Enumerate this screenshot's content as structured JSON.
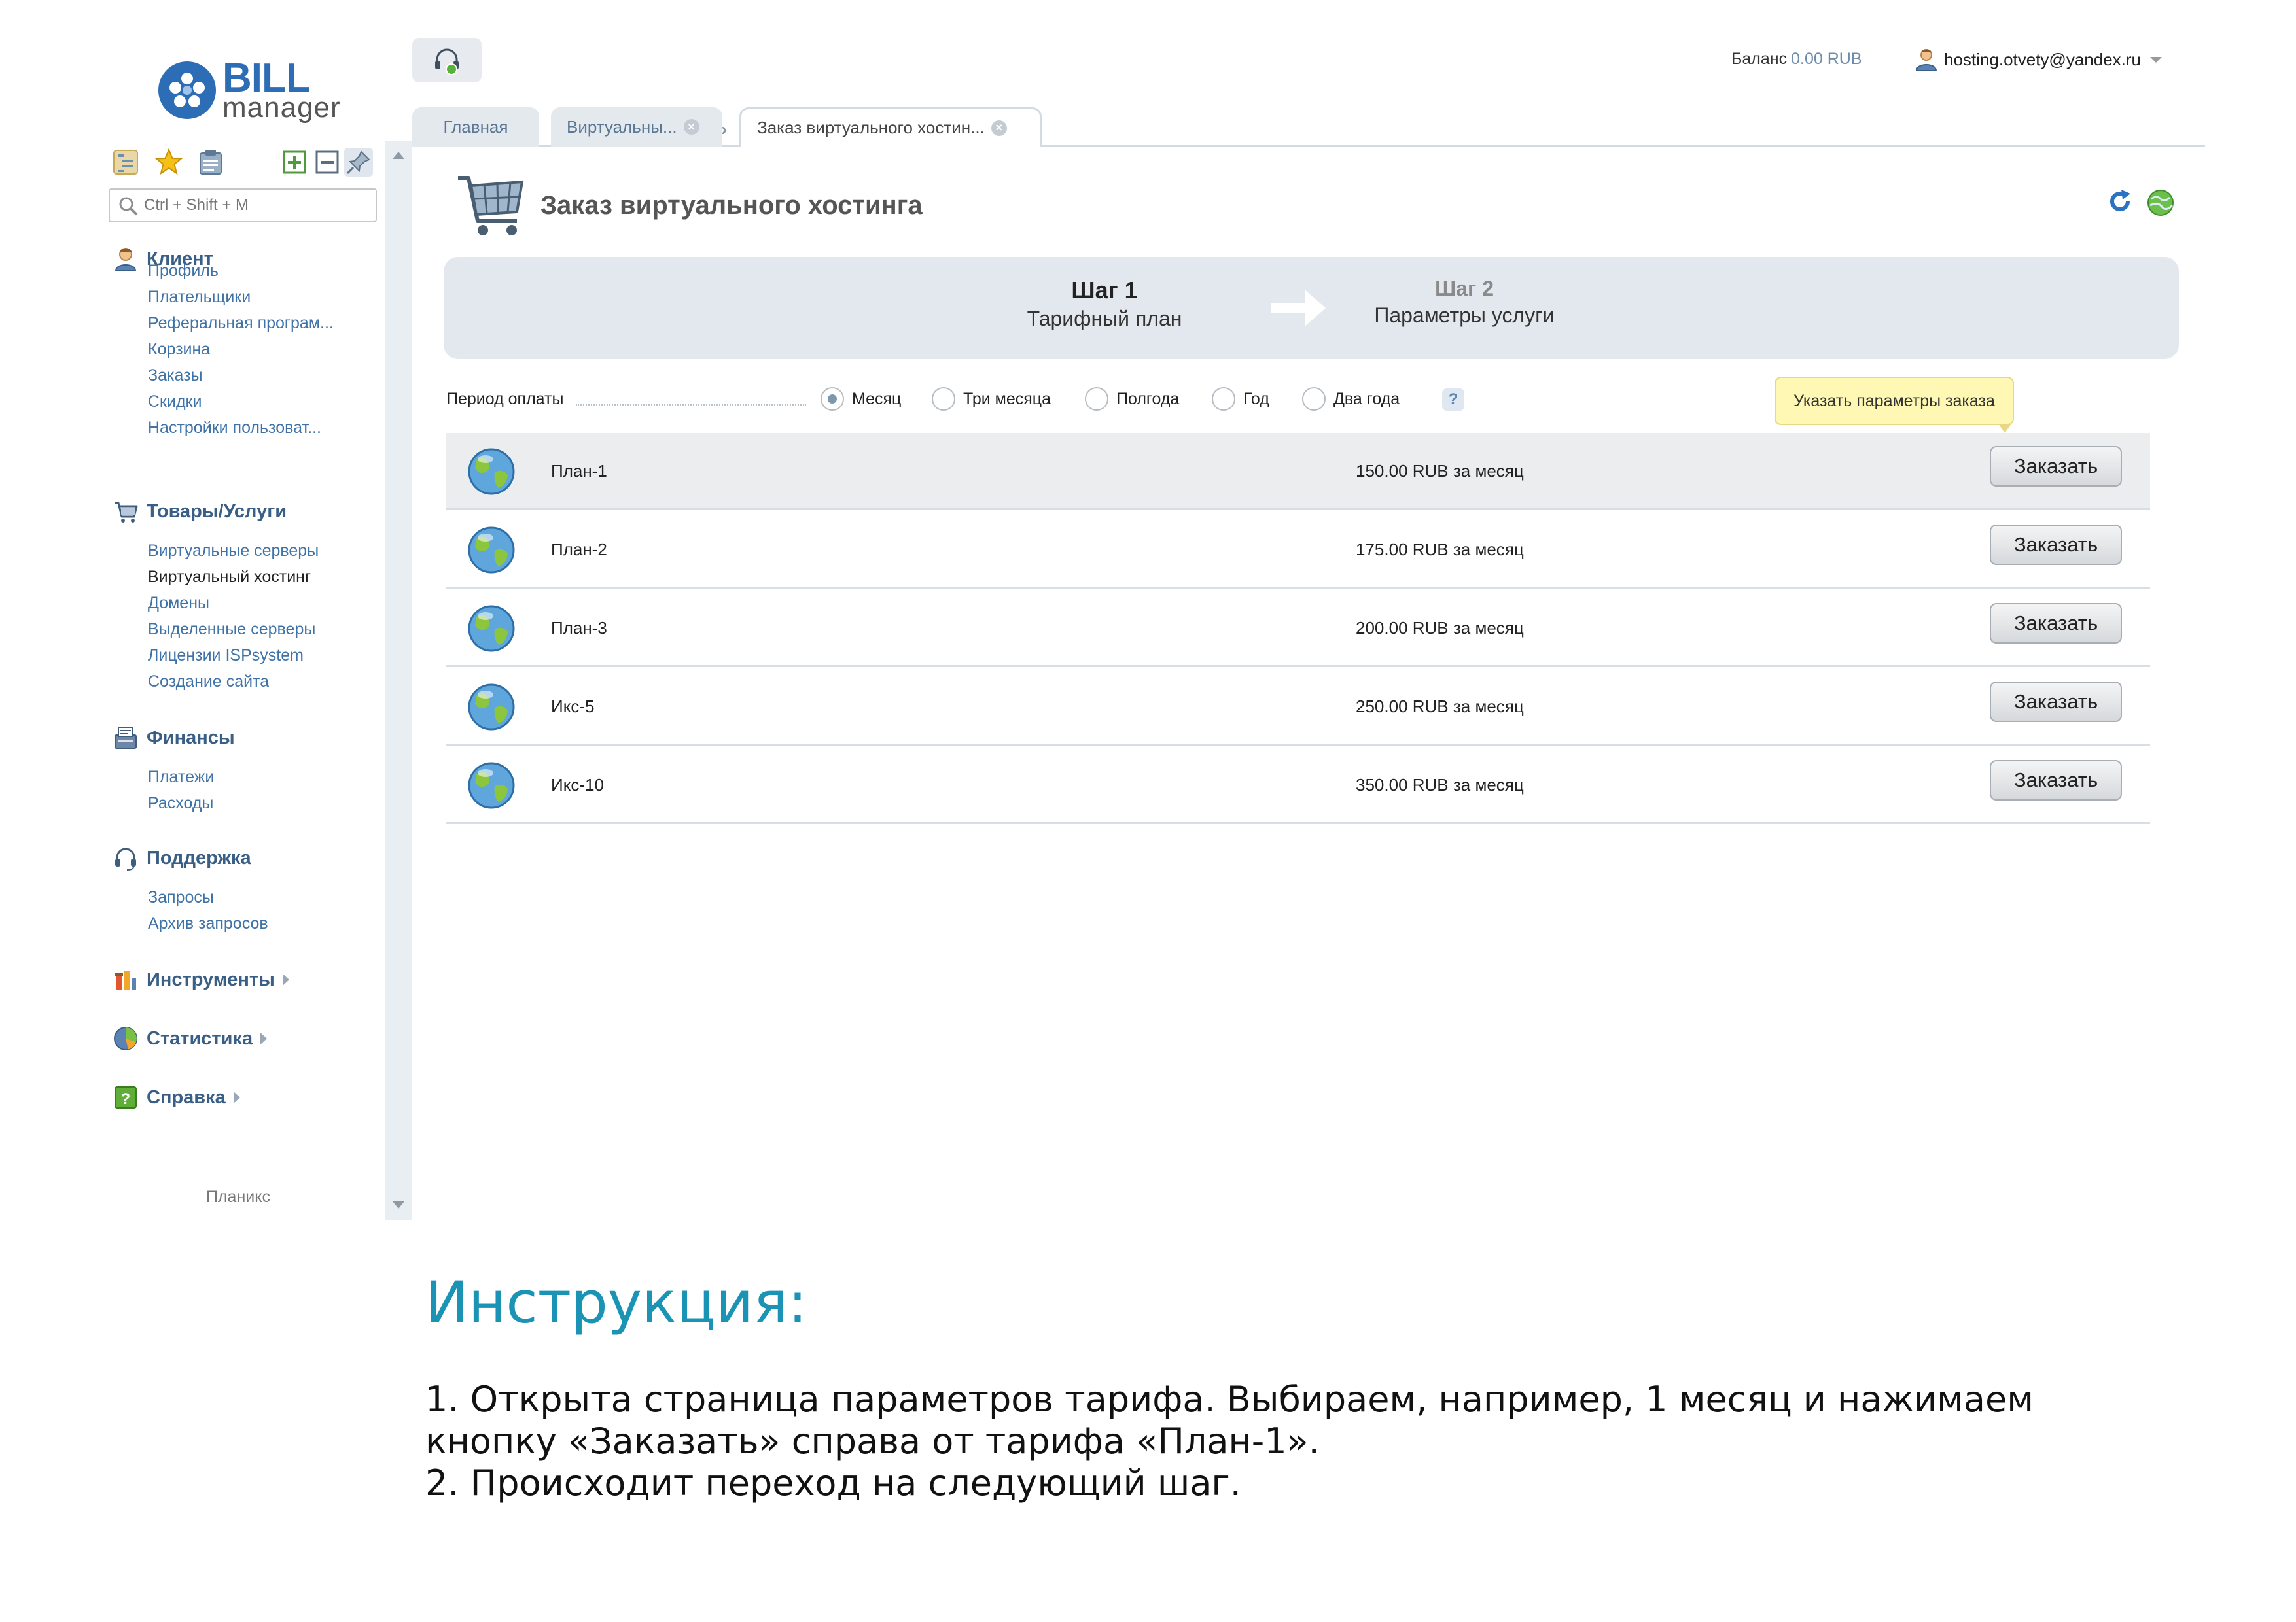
{
  "app": {
    "logo_primary": "BILL",
    "logo_secondary": "manager"
  },
  "topbar": {
    "balance_label": "Баланс",
    "balance_value": "0.00 RUB",
    "user_email": "hosting.otvety@yandex.ru"
  },
  "tabs": [
    {
      "label": "Главная"
    },
    {
      "label": "Виртуальны..."
    },
    {
      "label": "Заказ виртуального хостин..."
    }
  ],
  "sidebar": {
    "search_placeholder": "Ctrl + Shift + M",
    "sections": [
      {
        "title": "Клиент",
        "items": [
          "Профиль",
          "Плательщики",
          "Реферальная програм...",
          "Корзина",
          "Заказы",
          "Скидки",
          "Настройки пользоват..."
        ]
      },
      {
        "title": "Товары/Услуги",
        "items": [
          "Виртуальные серверы",
          "Виртуальный хостинг",
          "Домены",
          "Выделенные серверы",
          "Лицензии ISPsystem",
          "Создание сайта"
        ],
        "active_item": "Виртуальный хостинг"
      },
      {
        "title": "Финансы",
        "items": [
          "Платежи",
          "Расходы"
        ]
      },
      {
        "title": "Поддержка",
        "items": [
          "Запросы",
          "Архив запросов"
        ]
      },
      {
        "title": "Инструменты",
        "items": []
      },
      {
        "title": "Статистика",
        "items": []
      },
      {
        "title": "Справка",
        "items": []
      }
    ],
    "footer": "Планикс"
  },
  "page": {
    "title": "Заказ виртуального хостинга",
    "steps": [
      {
        "number": "Шаг 1",
        "label": "Тарифный план"
      },
      {
        "number": "Шаг 2",
        "label": "Параметры услуги"
      }
    ],
    "period": {
      "label": "Период оплаты",
      "options": [
        "Месяц",
        "Три месяца",
        "Полгода",
        "Год",
        "Два года"
      ],
      "selected": "Месяц",
      "help": "?"
    },
    "tooltip": "Указать параметры заказа",
    "plans": [
      {
        "name": "План-1",
        "price": "150.00 RUB за месяц",
        "button": "Заказать"
      },
      {
        "name": "План-2",
        "price": "175.00 RUB за месяц",
        "button": "Заказать"
      },
      {
        "name": "План-3",
        "price": "200.00 RUB за месяц",
        "button": "Заказать"
      },
      {
        "name": "Икс-5",
        "price": "250.00 RUB за месяц",
        "button": "Заказать"
      },
      {
        "name": "Икс-10",
        "price": "350.00 RUB за месяц",
        "button": "Заказать"
      }
    ]
  },
  "instructions": {
    "title": "Инструкция:",
    "lines": [
      "1. Открыта страница параметров тарифа. Выбираем, например, 1 месяц и нажимаем",
      "кнопку «Заказать» справа от тарифа «План-1».",
      "2. Происходит переход на следующий шаг."
    ]
  },
  "colors": {
    "link": "#3f73a8",
    "section": "#3a5f86",
    "instruction_title": "#1a93b5",
    "tooltip_bg": "#fff8b4",
    "steps_bg": "#e3e8ee"
  }
}
